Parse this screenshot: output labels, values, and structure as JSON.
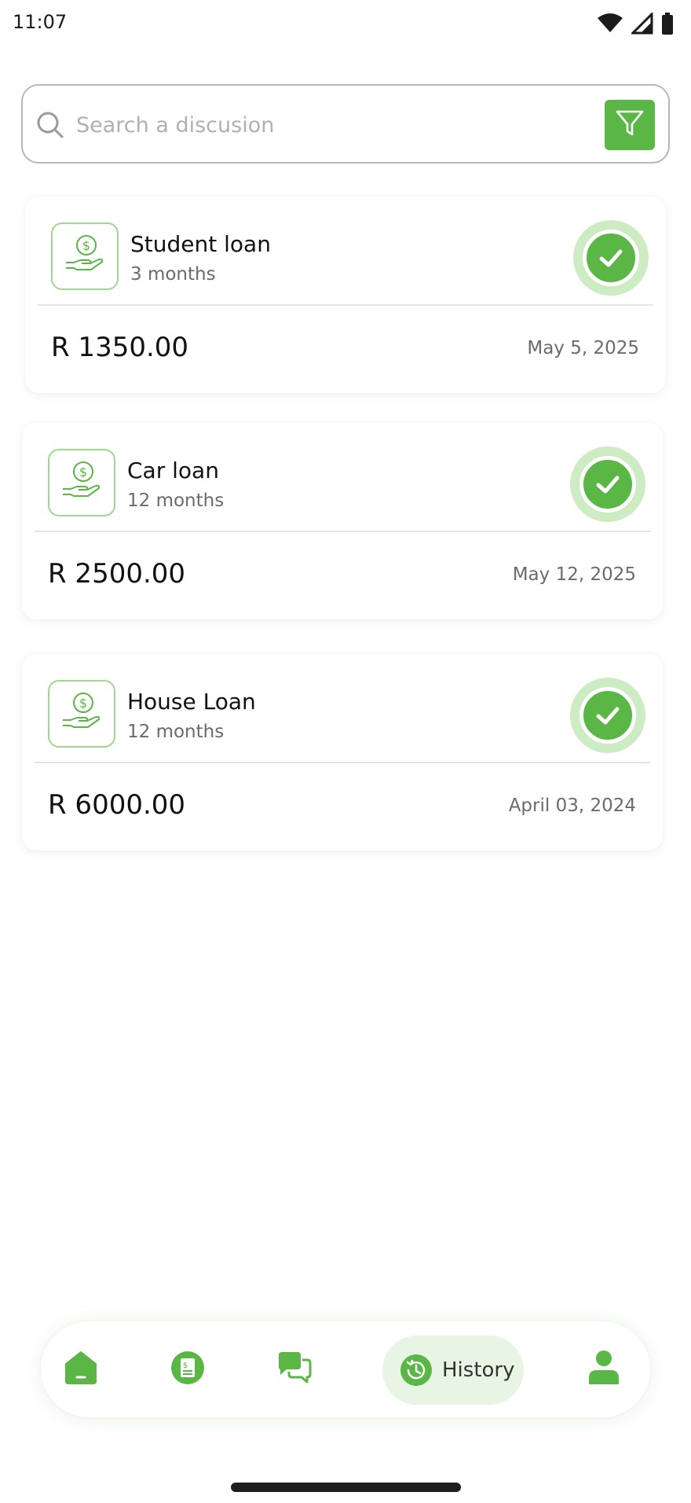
{
  "status_bar": {
    "time": "11:07",
    "icons": [
      "wifi-icon",
      "signal-icon",
      "battery-icon"
    ]
  },
  "search": {
    "placeholder": "Search a discusion",
    "value": ""
  },
  "loans": [
    {
      "title": "Student loan",
      "duration": "3 months",
      "amount": "R 1350.00",
      "date": "May 5, 2025",
      "icon": "money-hand-icon",
      "status_icon": "check-circle-icon"
    },
    {
      "title": "Car loan",
      "duration": "12 months",
      "amount": "R 2500.00",
      "date": "May 12, 2025",
      "icon": "money-hand-icon",
      "status_icon": "check-circle-icon"
    },
    {
      "title": "House Loan",
      "duration": "12 months",
      "amount": "R 6000.00",
      "date": "April 03, 2024",
      "icon": "money-hand-icon",
      "status_icon": "check-circle-icon"
    }
  ],
  "bottom_nav": {
    "items": [
      {
        "icon": "home-icon",
        "active": false
      },
      {
        "icon": "document-dollar-icon",
        "active": false
      },
      {
        "icon": "chat-icon",
        "active": false
      },
      {
        "icon": "history-icon",
        "label": "History",
        "active": true
      },
      {
        "icon": "profile-icon",
        "active": false
      }
    ]
  },
  "colors": {
    "accent": "#5ab645",
    "accent_light": "#cdecc3",
    "accent_bg": "#e8f5e4",
    "icon_border": "#9fd890",
    "text_primary": "#111111",
    "text_secondary": "#6b6b6b",
    "placeholder": "#b0b0b0"
  }
}
